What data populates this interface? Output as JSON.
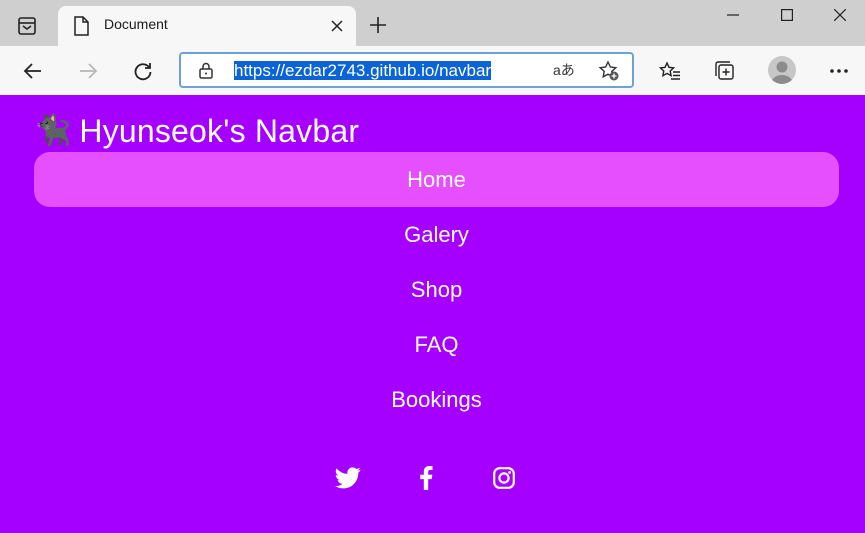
{
  "browser": {
    "tab_title": "Document",
    "url": "https://ezdar2743.github.io/navbar",
    "translate_glyph": "aあ"
  },
  "page": {
    "brand": {
      "logo_emoji": "🐈‍⬛",
      "name": "Hyunseok's Navbar"
    },
    "nav": {
      "items": [
        {
          "label": "Home",
          "active": true
        },
        {
          "label": "Galery",
          "active": false
        },
        {
          "label": "Shop",
          "active": false
        },
        {
          "label": "FAQ",
          "active": false
        },
        {
          "label": "Bookings",
          "active": false
        }
      ]
    },
    "social": [
      "twitter-icon",
      "facebook-icon",
      "instagram-icon"
    ]
  },
  "colors": {
    "page_background": "#a500ff",
    "active_nav_background": "#e54ffd",
    "text": "#ffffff"
  }
}
